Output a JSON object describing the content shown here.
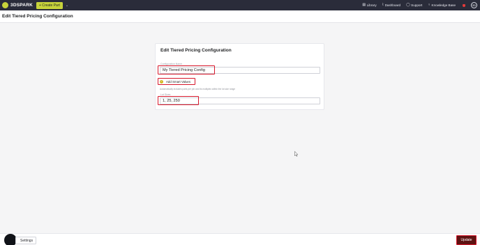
{
  "nav": {
    "brand": "3DSPARK",
    "create_label": "+ Create Part",
    "create_caret": "⌄",
    "links": [
      {
        "icon": "library-icon",
        "glyph": "▤",
        "label": "Library"
      },
      {
        "icon": "dashboard-icon",
        "glyph": "⌇",
        "label": "Dashboard"
      },
      {
        "icon": "support-icon",
        "glyph": "◯",
        "label": "Support"
      },
      {
        "icon": "lightbulb-icon",
        "glyph": "♀",
        "label": "Knowledge Base"
      }
    ],
    "user_initials": "SD",
    "bell_color": "#e23a3a"
  },
  "page": {
    "title": "Edit Tiered Pricing Configuration"
  },
  "card": {
    "title": "Edit Tiered Pricing Configuration",
    "config_name_label": "Configuration Name",
    "config_name_value": "My Tiered Pricing Config",
    "smart_values_label": "Add Smart Values",
    "help_text": "Automatically includes parts per job and its multiples within the lot size range",
    "lot_sizes_label": "Lot Sizes",
    "lot_sizes_value": "1, 25, 250"
  },
  "footer": {
    "settings_label": "Settings",
    "update_label": "Update"
  },
  "colors": {
    "nav_bg": "#2a2c3a",
    "accent_lime": "#c7d33b",
    "highlight_red": "#d7162a",
    "update_bg": "#5e1212",
    "check_gold": "#d2b51f"
  }
}
